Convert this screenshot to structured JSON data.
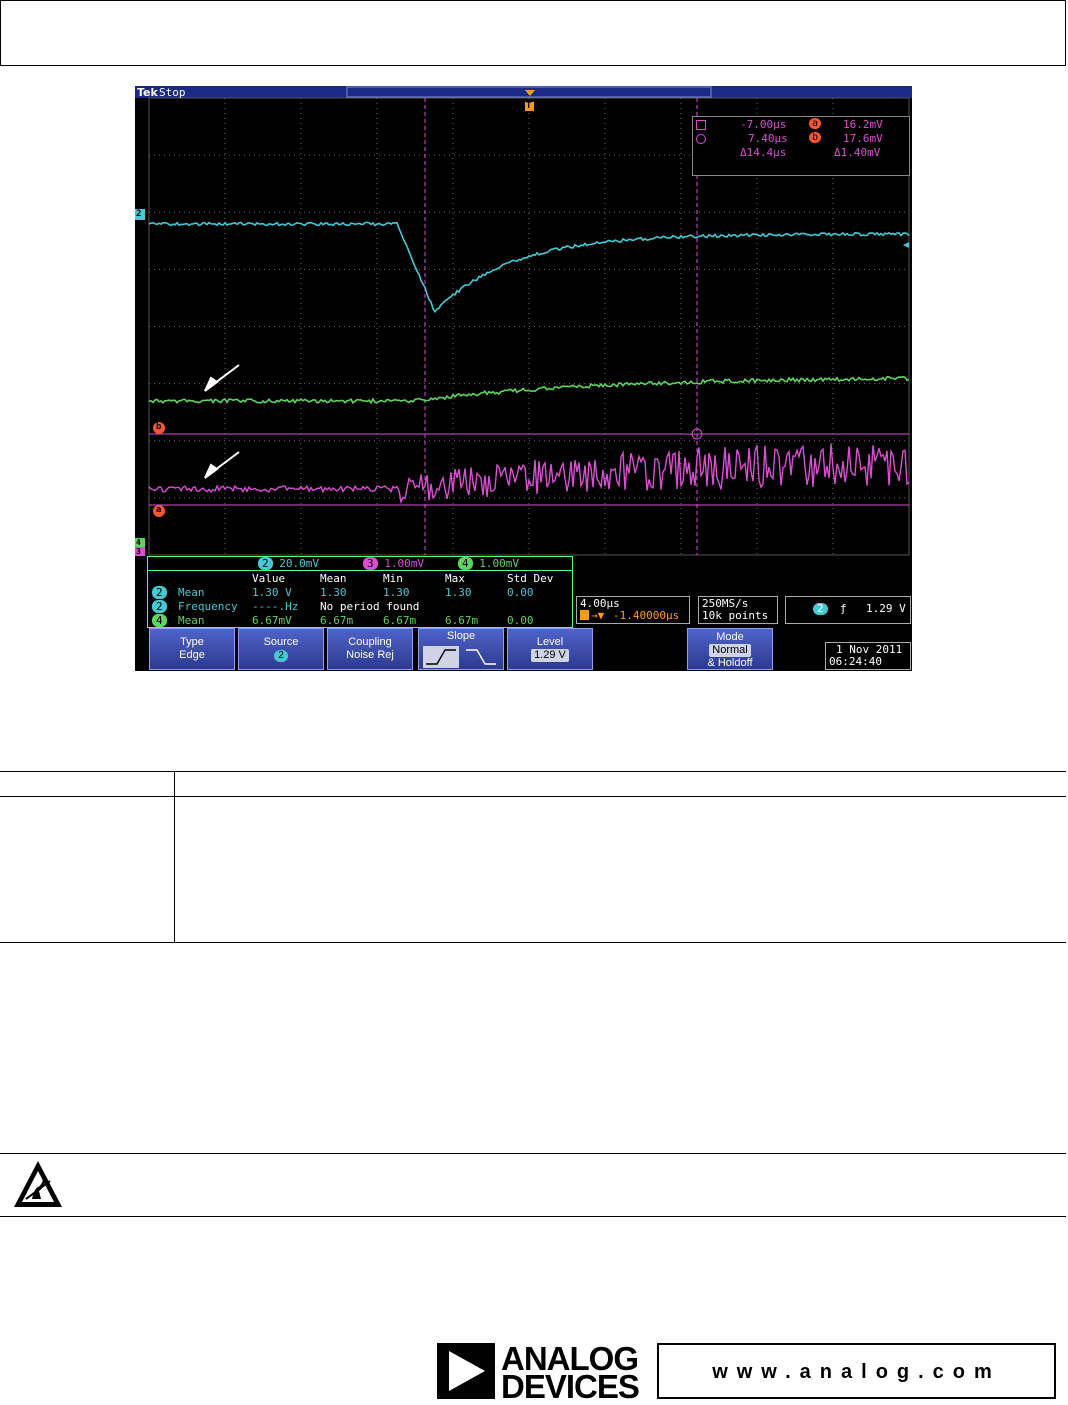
{
  "scope": {
    "brand": "Tek",
    "run_state": "Stop",
    "cursor_readout": {
      "t1": "-7.00µs",
      "t2": "7.40µs",
      "dt": "Δ14.4µs",
      "a_label": "a",
      "a_value": "16.2mV",
      "b_label": "b",
      "b_value": "17.6mV",
      "dv": "Δ1.40mV"
    },
    "channel_scales": [
      {
        "ch": "2",
        "scale": "20.0mV",
        "color": "#45c9d4"
      },
      {
        "ch": "3",
        "scale": "1.00mV",
        "color": "#d94fd2"
      },
      {
        "ch": "4",
        "scale": "1.00mV",
        "color": "#5fd35f"
      }
    ],
    "measurements": {
      "headers": [
        "Value",
        "Mean",
        "Min",
        "Max",
        "Std Dev"
      ],
      "rows": [
        {
          "ch": "2",
          "name": "Mean",
          "value": "1.30 V",
          "mean": "1.30",
          "min": "1.30",
          "max": "1.30",
          "std": "0.00"
        },
        {
          "ch": "2",
          "name": "Frequency",
          "value": "----.Hz",
          "note": "No period found"
        },
        {
          "ch": "4",
          "name": "Mean",
          "value": "6.67mV",
          "mean": "6.67m",
          "min": "6.67m",
          "max": "6.67m",
          "std": "0.00"
        }
      ]
    },
    "timebase": {
      "per_div": "4.00µs",
      "delay": "-1.40000µs"
    },
    "acquisition": {
      "rate": "250MS/s",
      "points": "10k points"
    },
    "trigger": {
      "ch": "2",
      "level": "1.29 V"
    },
    "softkeys": {
      "type": {
        "label": "Type",
        "value": "Edge"
      },
      "source": {
        "label": "Source",
        "value": "2"
      },
      "coupling": {
        "label": "Coupling",
        "value": "Noise Rej"
      },
      "slope": {
        "label": "Slope"
      },
      "level": {
        "label": "Level",
        "value": "1.29 V"
      },
      "mode": {
        "label": "Mode",
        "value": "Normal",
        "value2": "& Holdoff"
      }
    },
    "date": "1 Nov 2011",
    "time": "06:24:40",
    "markers": {
      "ch2": "2",
      "ch3": "3",
      "ch4": "4",
      "a": "a",
      "b": "b",
      "trig": "T"
    },
    "colors": {
      "ch2": "#45c9d4",
      "ch3": "#d94fd2",
      "ch4": "#5fd35f",
      "cursor_ref": "#ff5533",
      "trigger": "#ff9a1a"
    }
  },
  "footer": {
    "logo_line1": "ANALOG",
    "logo_line2": "DEVICES",
    "url": "www.analog.com"
  }
}
